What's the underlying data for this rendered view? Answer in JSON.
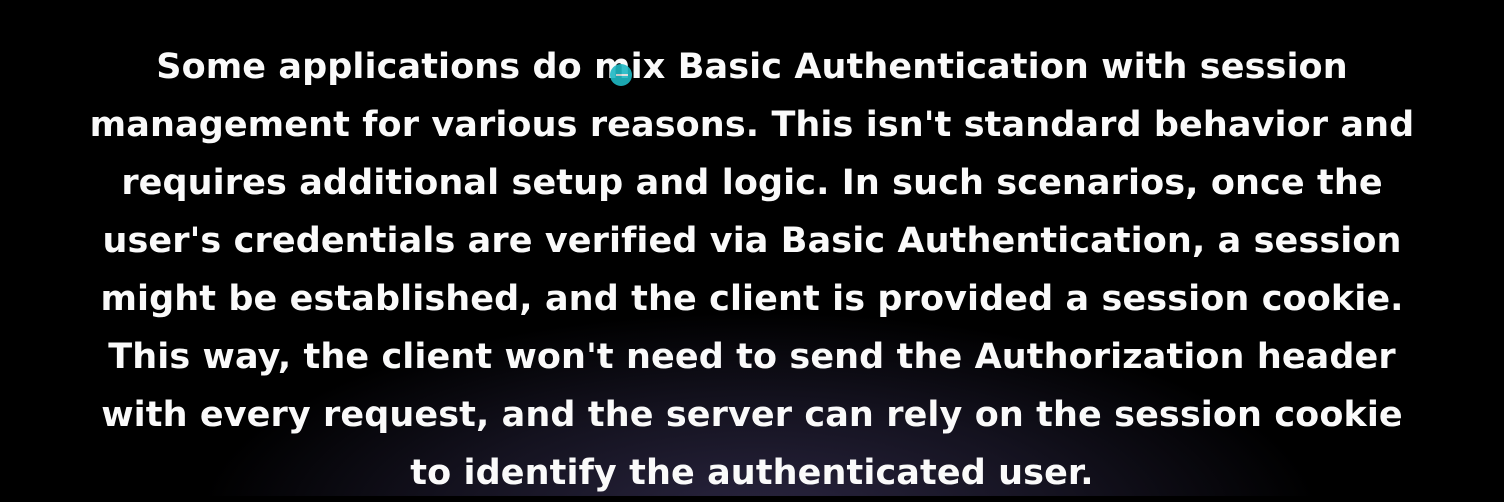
{
  "slide": {
    "lines": [
      "Some applications do mix Basic Authentication with session",
      "management for various reasons. This isn't standard behavior and",
      "requires additional setup and logic. In such scenarios, once the",
      "user's credentials are verified via Basic Authentication, a session",
      "might be established, and the client is provided a session cookie.",
      "This way, the client won't need to send the Authorization header",
      "with every request, and the server can rely on the session cookie",
      "to identify the authenticated user."
    ]
  },
  "colors": {
    "background": "#000000",
    "text": "#fafafa",
    "cursor": "#1fb8c4"
  }
}
